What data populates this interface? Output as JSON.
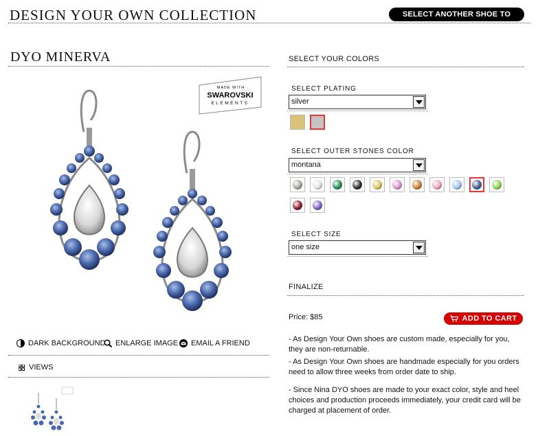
{
  "header": {
    "title": "DESIGN YOUR OWN COLLECTION",
    "select_shoe_label": "SELECT ANOTHER SHOE TO DESIGN"
  },
  "product": {
    "title": "DYO MINERVA",
    "badge_top": "MADE WITH",
    "badge_brand": "SWAROVSKI",
    "badge_bottom": "ELEMENTS"
  },
  "left_actions": {
    "dark_background": "DARK BACKGROUND",
    "enlarge_image": "ENLARGE IMAGE",
    "email_friend": "EMAIL A FRIEND",
    "views": "VIEWS"
  },
  "colors_section": {
    "title": "SELECT YOUR COLORS",
    "plating_label": "SELECT PLATING",
    "plating_value": "silver",
    "plating_swatches": [
      {
        "name": "gold",
        "color": "#d9c27a",
        "selected": false
      },
      {
        "name": "silver",
        "color": "#c4c4c4",
        "selected": true
      }
    ],
    "stones_label": "SELECT OUTER STONES COLOR",
    "stones_value": "montana",
    "stone_swatches": [
      {
        "color": "#a8a196",
        "selected": false
      },
      {
        "color": "#e1e1e1",
        "selected": false
      },
      {
        "color": "#1f8a4c",
        "selected": false
      },
      {
        "color": "#2a2a2a",
        "selected": false
      },
      {
        "color": "#d8c25a",
        "selected": false
      },
      {
        "color": "#d48fd0",
        "selected": false
      },
      {
        "color": "#c77b28",
        "selected": false
      },
      {
        "color": "#f09bbd",
        "selected": false
      },
      {
        "color": "#9cc3ee",
        "selected": false
      },
      {
        "color": "#3d5b8e",
        "selected": true
      },
      {
        "color": "#8fd050",
        "selected": false
      },
      {
        "color": "#8a1420",
        "selected": false
      },
      {
        "color": "#7b5ec9",
        "selected": false
      }
    ],
    "size_label": "SELECT SIZE",
    "size_value": "one size"
  },
  "finalize": {
    "title": "FINALIZE",
    "price": "Price: $85",
    "add_to_cart": "ADD TO CART",
    "notes": [
      "- As Design Your Own shoes are custom made, especially for you, they are non-returnable.",
      "- As Design Your Own shoes are handmade especially for you orders need to allow three weeks from order date to ship.",
      "- Since Nina DYO shoes are made to your exact color, style and heel choices and production proceeds immediately, your credit card will be charged at placement of order."
    ]
  }
}
